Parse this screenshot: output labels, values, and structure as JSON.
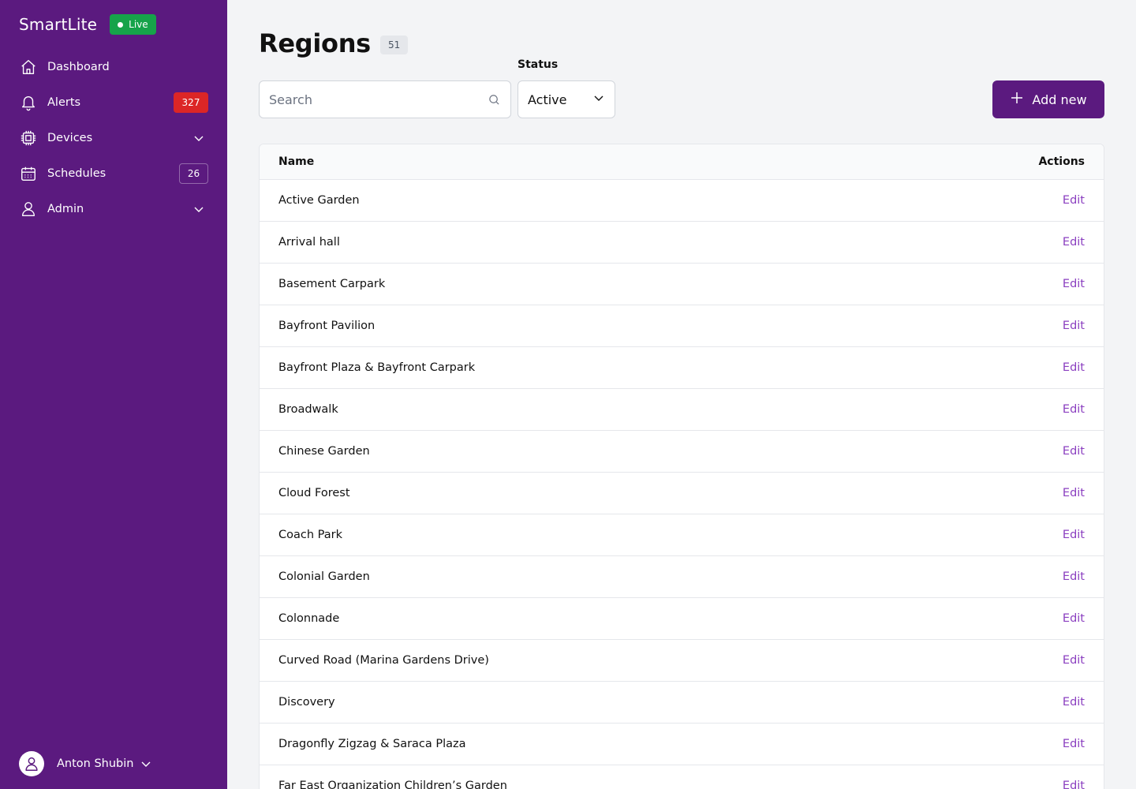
{
  "app": {
    "name": "SmartLite",
    "live_label": "Live"
  },
  "sidebar": {
    "items": [
      {
        "label": "Dashboard",
        "icon": "home-icon"
      },
      {
        "label": "Alerts",
        "icon": "bell-icon",
        "count": "327"
      },
      {
        "label": "Devices",
        "icon": "chip-icon"
      },
      {
        "label": "Schedules",
        "icon": "calendar-icon",
        "count": "26"
      },
      {
        "label": "Admin",
        "icon": "user-icon"
      }
    ]
  },
  "user": {
    "name": "Anton Shubin"
  },
  "page": {
    "title": "Regions",
    "count": "51"
  },
  "search": {
    "placeholder": "Search",
    "value": ""
  },
  "status": {
    "label": "Status",
    "value": "Active"
  },
  "add_button": {
    "label": "Add new"
  },
  "table": {
    "headers": {
      "name": "Name",
      "actions": "Actions"
    },
    "edit_label": "Edit",
    "rows": [
      "Active Garden",
      "Arrival hall",
      "Basement Carpark",
      "Bayfront Pavilion",
      "Bayfront Plaza & Bayfront Carpark",
      "Broadwalk",
      "Chinese Garden",
      "Cloud Forest",
      "Coach Park",
      "Colonial Garden",
      "Colonnade",
      "Curved Road (Marina Gardens Drive)",
      "Discovery",
      "Dragonfly Zigzag & Saraca Plaza",
      "Far East Organization Children’s Garden"
    ]
  },
  "colors": {
    "sidebar": "#5b1a7f",
    "accent": "#5b1a7f",
    "link": "#8b3fc0",
    "live": "#16a34a",
    "alert": "#dc2626"
  }
}
